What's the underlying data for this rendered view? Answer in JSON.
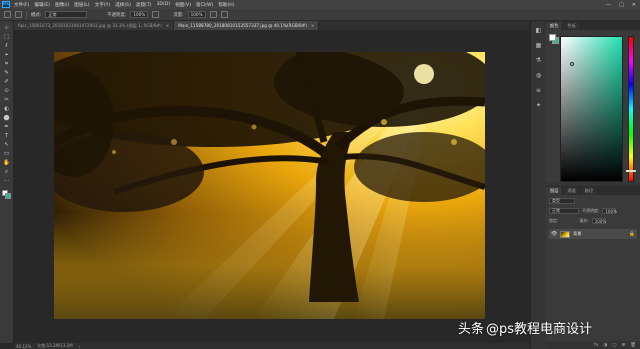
{
  "app": {
    "logo": "Ps"
  },
  "menu": [
    "文件(F)",
    "编辑(E)",
    "图像(I)",
    "图层(L)",
    "文字(Y)",
    "选择(S)",
    "滤镜(T)",
    "3D(D)",
    "视图(V)",
    "窗口(W)",
    "帮助(H)"
  ],
  "window_controls": {
    "minimize": "—",
    "maximize": "□",
    "close": "✕"
  },
  "options": {
    "mode_label": "模式:",
    "mode_value": "正常",
    "opacity_label": "不透明度:",
    "opacity_value": "100%",
    "flow_label": "流量:",
    "flow_value": "100%"
  },
  "tabs": [
    {
      "label": "flpic_15881673_20181023043472003.jpg @ 33.3% (图层 1, RGB/8#)",
      "close": "×"
    },
    {
      "label": "Main_11588780_20180810153557337.jpg @ 40.1%(RGB/8#)",
      "close": "×"
    }
  ],
  "tools": [
    "⊹",
    "⬚",
    "ℓ",
    "⌖",
    "⌗",
    "✎",
    "✐",
    "⊙",
    "✂",
    "◐",
    "⬤",
    "✒",
    "T",
    "↖",
    "▭",
    "✋",
    "⌕",
    "⋯"
  ],
  "colors": {
    "foreground": "#ffffff",
    "background": "#2fb89a",
    "accent": "#31a8ff"
  },
  "status": {
    "zoom": "40.12%",
    "doc": "文档:13.2M/13.2M",
    "arrow": "›"
  },
  "right_strip_icons": [
    "◧",
    "▦",
    "⚗",
    "◍",
    "≡",
    "✦"
  ],
  "color_panel": {
    "tabs": [
      "颜色",
      "色板"
    ]
  },
  "layers_panel": {
    "tabs": [
      "图层",
      "通道",
      "路径"
    ],
    "kind_label": "类型",
    "blend": "正常",
    "opacity_label": "不透明度:",
    "lock_label": "锁定:",
    "fill_label": "填充:",
    "layers": [
      {
        "name": "背景",
        "visible_glyph": "👁",
        "lock": "🔒"
      }
    ],
    "footer_icons": [
      "fx",
      "◑",
      "▢",
      "⊞",
      "🗑"
    ]
  },
  "watermark": {
    "platform": "头条",
    "account": "@ps教程电商设计"
  }
}
